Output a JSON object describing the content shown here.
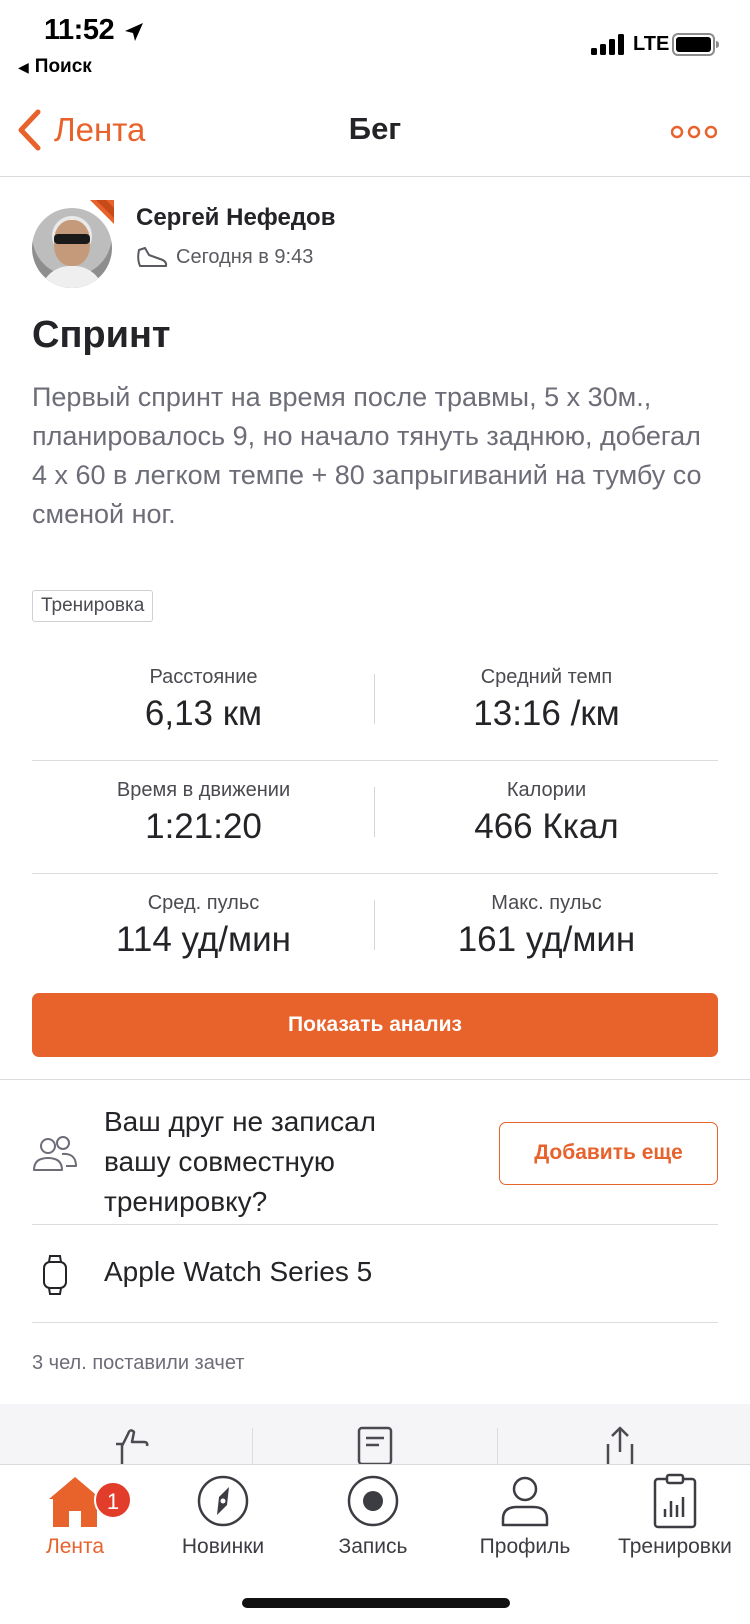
{
  "status": {
    "time": "11:52",
    "back_app": "Поиск",
    "network": "LTE"
  },
  "nav": {
    "back_label": "Лента",
    "title": "Бег"
  },
  "author": {
    "name": "Сергей Нефедов",
    "timestamp": "Сегодня в 9:43"
  },
  "activity": {
    "title": "Спринт",
    "description": "Первый спринт на время после травмы, 5 х 30м., планировалось 9, но начало тянуть заднюю, добегал 4 х 60 в легком темпе + 80 запрыгиваний на тумбу со сменой ног.",
    "tag": "Тренировка"
  },
  "stats": {
    "distance_label": "Расстояние",
    "distance_value": "6,13 км",
    "pace_label": "Средний темп",
    "pace_value": "13:16 /км",
    "moving_time_label": "Время в движении",
    "moving_time_value": "1:21:20",
    "calories_label": "Калории",
    "calories_value": "466 Ккал",
    "avg_hr_label": "Сред. пульс",
    "avg_hr_value": "114 уд/мин",
    "max_hr_label": "Макс. пульс",
    "max_hr_value": "161 уд/мин"
  },
  "analysis_button": "Показать анализ",
  "friend": {
    "text": "Ваш друг не записал вашу совместную тренировку?",
    "add_button": "Добавить еще"
  },
  "device": {
    "name": "Apple Watch Series 5"
  },
  "kudos_text": "3 чел. поставили зачет",
  "tabs": {
    "feed": "Лента",
    "feed_badge": "1",
    "explore": "Новинки",
    "record": "Запись",
    "profile": "Профиль",
    "trainings": "Тренировки"
  },
  "colors": {
    "accent": "#e8622c",
    "badge": "#e23d2b",
    "text": "#242428",
    "secondary_text": "#6d6d78"
  }
}
